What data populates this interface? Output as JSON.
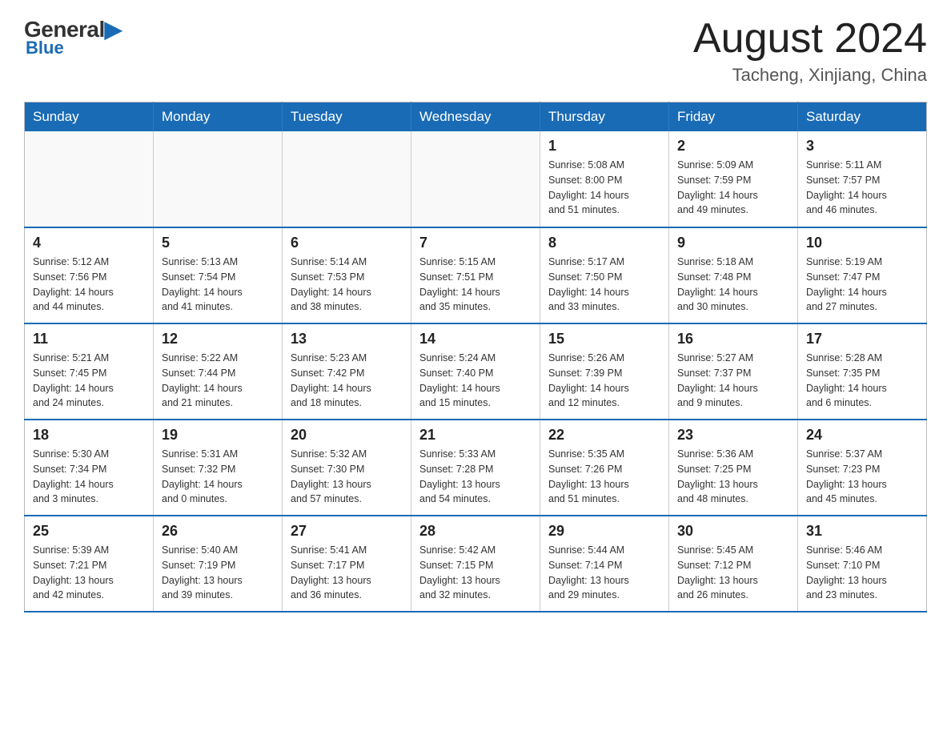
{
  "header": {
    "logo_general": "General",
    "logo_blue": "Blue",
    "month_year": "August 2024",
    "location": "Tacheng, Xinjiang, China"
  },
  "days_of_week": [
    "Sunday",
    "Monday",
    "Tuesday",
    "Wednesday",
    "Thursday",
    "Friday",
    "Saturday"
  ],
  "weeks": [
    [
      {
        "day": "",
        "info": ""
      },
      {
        "day": "",
        "info": ""
      },
      {
        "day": "",
        "info": ""
      },
      {
        "day": "",
        "info": ""
      },
      {
        "day": "1",
        "info": "Sunrise: 5:08 AM\nSunset: 8:00 PM\nDaylight: 14 hours\nand 51 minutes."
      },
      {
        "day": "2",
        "info": "Sunrise: 5:09 AM\nSunset: 7:59 PM\nDaylight: 14 hours\nand 49 minutes."
      },
      {
        "day": "3",
        "info": "Sunrise: 5:11 AM\nSunset: 7:57 PM\nDaylight: 14 hours\nand 46 minutes."
      }
    ],
    [
      {
        "day": "4",
        "info": "Sunrise: 5:12 AM\nSunset: 7:56 PM\nDaylight: 14 hours\nand 44 minutes."
      },
      {
        "day": "5",
        "info": "Sunrise: 5:13 AM\nSunset: 7:54 PM\nDaylight: 14 hours\nand 41 minutes."
      },
      {
        "day": "6",
        "info": "Sunrise: 5:14 AM\nSunset: 7:53 PM\nDaylight: 14 hours\nand 38 minutes."
      },
      {
        "day": "7",
        "info": "Sunrise: 5:15 AM\nSunset: 7:51 PM\nDaylight: 14 hours\nand 35 minutes."
      },
      {
        "day": "8",
        "info": "Sunrise: 5:17 AM\nSunset: 7:50 PM\nDaylight: 14 hours\nand 33 minutes."
      },
      {
        "day": "9",
        "info": "Sunrise: 5:18 AM\nSunset: 7:48 PM\nDaylight: 14 hours\nand 30 minutes."
      },
      {
        "day": "10",
        "info": "Sunrise: 5:19 AM\nSunset: 7:47 PM\nDaylight: 14 hours\nand 27 minutes."
      }
    ],
    [
      {
        "day": "11",
        "info": "Sunrise: 5:21 AM\nSunset: 7:45 PM\nDaylight: 14 hours\nand 24 minutes."
      },
      {
        "day": "12",
        "info": "Sunrise: 5:22 AM\nSunset: 7:44 PM\nDaylight: 14 hours\nand 21 minutes."
      },
      {
        "day": "13",
        "info": "Sunrise: 5:23 AM\nSunset: 7:42 PM\nDaylight: 14 hours\nand 18 minutes."
      },
      {
        "day": "14",
        "info": "Sunrise: 5:24 AM\nSunset: 7:40 PM\nDaylight: 14 hours\nand 15 minutes."
      },
      {
        "day": "15",
        "info": "Sunrise: 5:26 AM\nSunset: 7:39 PM\nDaylight: 14 hours\nand 12 minutes."
      },
      {
        "day": "16",
        "info": "Sunrise: 5:27 AM\nSunset: 7:37 PM\nDaylight: 14 hours\nand 9 minutes."
      },
      {
        "day": "17",
        "info": "Sunrise: 5:28 AM\nSunset: 7:35 PM\nDaylight: 14 hours\nand 6 minutes."
      }
    ],
    [
      {
        "day": "18",
        "info": "Sunrise: 5:30 AM\nSunset: 7:34 PM\nDaylight: 14 hours\nand 3 minutes."
      },
      {
        "day": "19",
        "info": "Sunrise: 5:31 AM\nSunset: 7:32 PM\nDaylight: 14 hours\nand 0 minutes."
      },
      {
        "day": "20",
        "info": "Sunrise: 5:32 AM\nSunset: 7:30 PM\nDaylight: 13 hours\nand 57 minutes."
      },
      {
        "day": "21",
        "info": "Sunrise: 5:33 AM\nSunset: 7:28 PM\nDaylight: 13 hours\nand 54 minutes."
      },
      {
        "day": "22",
        "info": "Sunrise: 5:35 AM\nSunset: 7:26 PM\nDaylight: 13 hours\nand 51 minutes."
      },
      {
        "day": "23",
        "info": "Sunrise: 5:36 AM\nSunset: 7:25 PM\nDaylight: 13 hours\nand 48 minutes."
      },
      {
        "day": "24",
        "info": "Sunrise: 5:37 AM\nSunset: 7:23 PM\nDaylight: 13 hours\nand 45 minutes."
      }
    ],
    [
      {
        "day": "25",
        "info": "Sunrise: 5:39 AM\nSunset: 7:21 PM\nDaylight: 13 hours\nand 42 minutes."
      },
      {
        "day": "26",
        "info": "Sunrise: 5:40 AM\nSunset: 7:19 PM\nDaylight: 13 hours\nand 39 minutes."
      },
      {
        "day": "27",
        "info": "Sunrise: 5:41 AM\nSunset: 7:17 PM\nDaylight: 13 hours\nand 36 minutes."
      },
      {
        "day": "28",
        "info": "Sunrise: 5:42 AM\nSunset: 7:15 PM\nDaylight: 13 hours\nand 32 minutes."
      },
      {
        "day": "29",
        "info": "Sunrise: 5:44 AM\nSunset: 7:14 PM\nDaylight: 13 hours\nand 29 minutes."
      },
      {
        "day": "30",
        "info": "Sunrise: 5:45 AM\nSunset: 7:12 PM\nDaylight: 13 hours\nand 26 minutes."
      },
      {
        "day": "31",
        "info": "Sunrise: 5:46 AM\nSunset: 7:10 PM\nDaylight: 13 hours\nand 23 minutes."
      }
    ]
  ]
}
